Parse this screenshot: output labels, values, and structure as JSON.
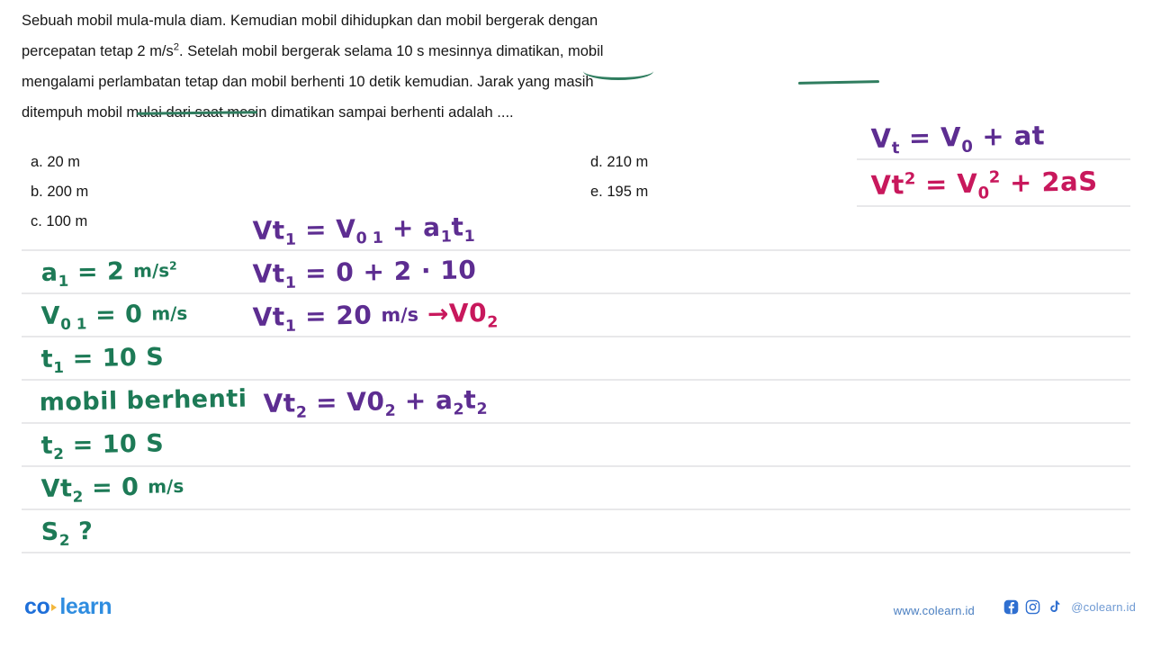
{
  "question": {
    "line1": "Sebuah mobil mula-mula diam. Kemudian mobil dihidupkan dan mobil bergerak dengan",
    "line2_pre": "percepatan tetap 2 m/s",
    "line2_sup": "2",
    "line2_post": ". Setelah mobil bergerak selama 10 s mesinnya dimatikan, mobil",
    "line3": "mengalami perlambatan tetap dan mobil berhenti 10 detik kemudian. Jarak yang masih",
    "line4": "ditempuh mobil mulai dari saat mesin dimatikan sampai berhenti adalah ...."
  },
  "options": {
    "a": "a. 20 m",
    "b": "b. 200 m",
    "c": "c. 100 m",
    "d": "d. 210 m",
    "e": "e. 195 m"
  },
  "annotations": {
    "formula_vt_pre": "V",
    "formula_vt_sub": "t",
    "formula_vt_rest": " = V",
    "formula_vt_sub0": "0",
    "formula_vt_tail": " + at",
    "formula_vt2_a": "Vt",
    "formula_vt2_sup": "2",
    "formula_vt2_b": " = V",
    "formula_vt2_sub0": "0",
    "formula_vt2_sup2": "2",
    "formula_vt2_tail": " + 2aS",
    "a1_label": "a",
    "a1_sub": "1",
    "a1_value": " = 2 ",
    "a1_unit_num": "m",
    "a1_unit_den": "/s",
    "a1_unit_sup": "2",
    "v01_label": "V",
    "v01_sub": "0 1",
    "v01_value": " = 0 ",
    "v01_unit": "m/s",
    "t1_label": "t",
    "t1_sub": "1",
    "t1_value": " = 10 S",
    "berhenti": "mobil berhenti",
    "t2_label": "t",
    "t2_sub": "2",
    "t2_value": " = 10 S",
    "vt2f_label": "Vt",
    "vt2f_sub": "2",
    "vt2f_value": " = 0 ",
    "vt2f_unit": "m/s",
    "s2_label": "S",
    "s2_sub": "2",
    "s2_value": " ?",
    "eq1_a": "Vt",
    "eq1_sub1": "1",
    "eq1_b": " = V",
    "eq1_sub2": "0 1",
    "eq1_c": " + a",
    "eq1_sub3": "1",
    "eq1_d": "t",
    "eq1_sub4": "1",
    "eq2_a": "Vt",
    "eq2_sub1": "1",
    "eq2_b": " = 0 + 2 · 10",
    "eq3_a": "Vt",
    "eq3_sub1": "1",
    "eq3_b": " = 20 ",
    "eq3_unit": "m/s",
    "eq3_arrow": "→",
    "eq3_tail": "V0",
    "eq3_sub2": "2",
    "eq4_a": "Vt",
    "eq4_sub1": "2",
    "eq4_b": " = V0",
    "eq4_sub2": "2",
    "eq4_c": " + a",
    "eq4_sub3": "2",
    "eq4_d": "t",
    "eq4_sub4": "2"
  },
  "footer": {
    "logo_co": "co",
    "logo_learn": "learn",
    "website": "www.colearn.id",
    "handle": "@colearn.id"
  },
  "colors": {
    "green": "#1d7a56",
    "purple": "#5d2d91",
    "magenta": "#c8185c",
    "rule": "#e8e8ea",
    "logo_co": "#1e6fd9",
    "logo_learn": "#2f8de0",
    "link": "#4a7fc1"
  }
}
